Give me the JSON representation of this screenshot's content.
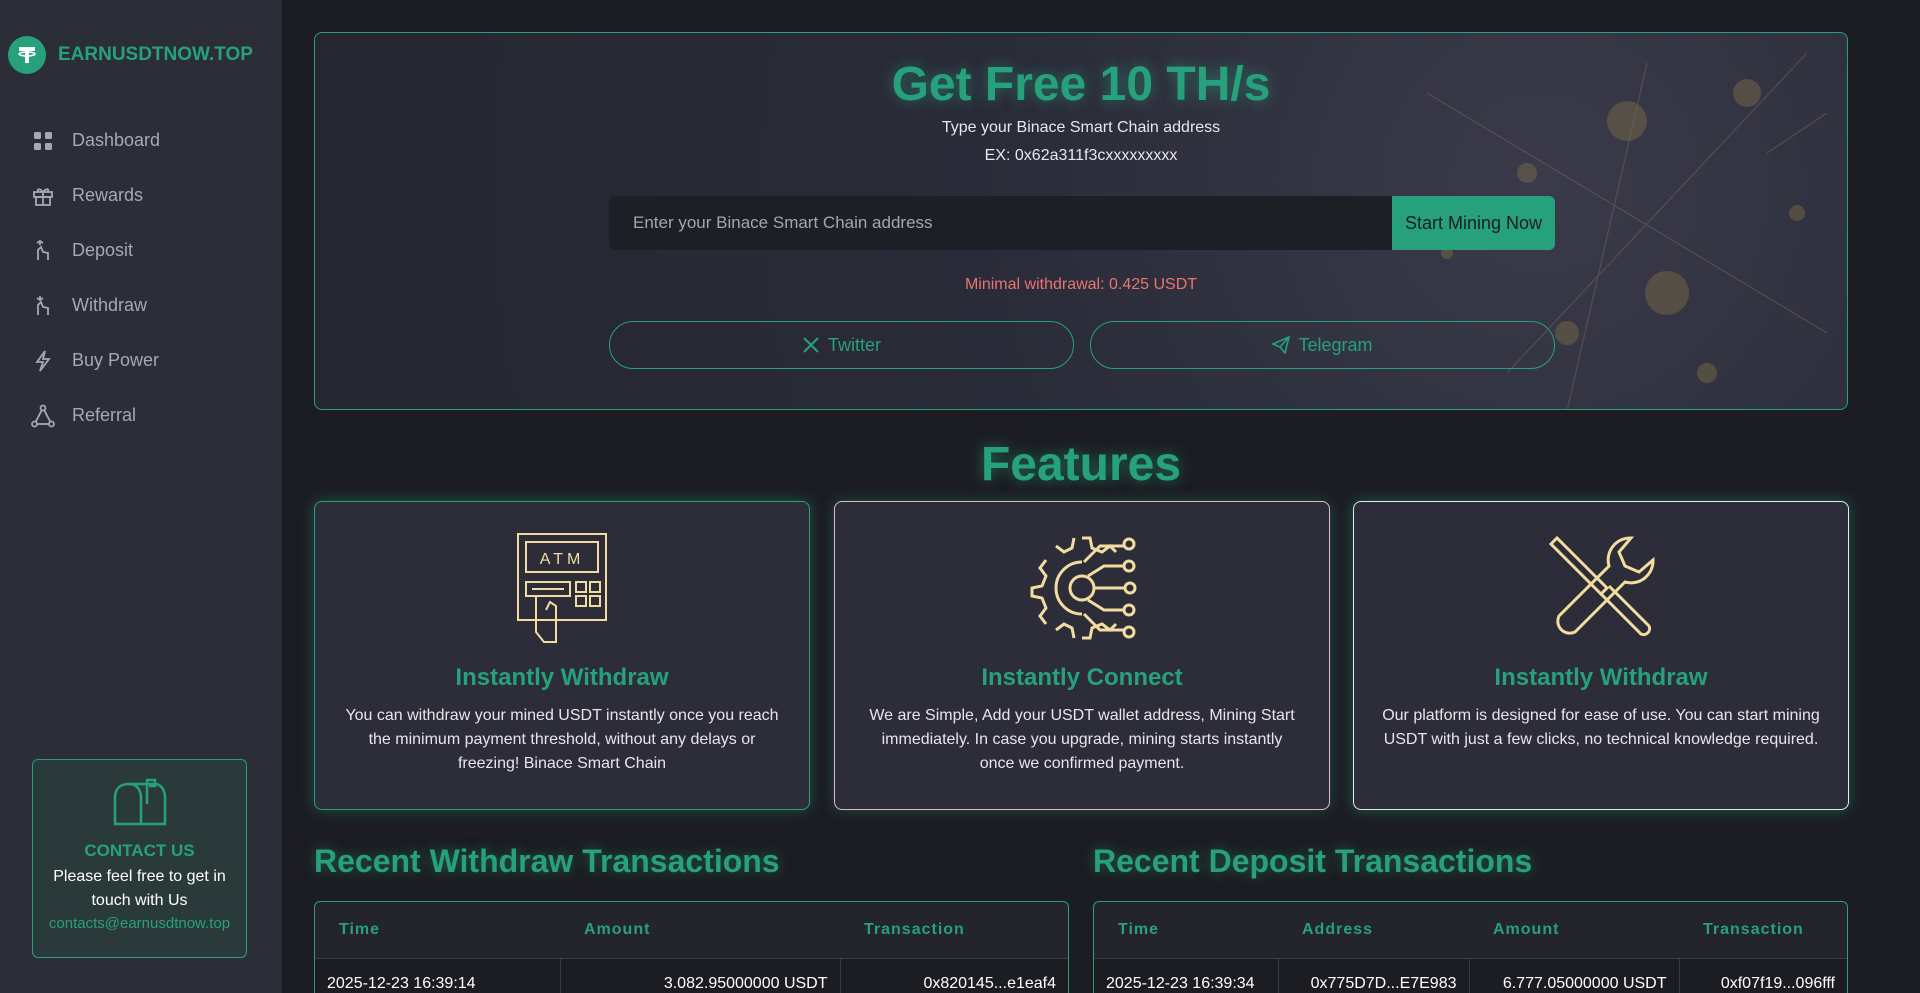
{
  "brand": {
    "name": "EARNUSDTNOW.TOP",
    "logo_icon": "tether-icon",
    "accent": "#26a17b"
  },
  "sidebar": {
    "items": [
      {
        "label": "Dashboard",
        "icon": "grid-icon"
      },
      {
        "label": "Rewards",
        "icon": "gift-icon"
      },
      {
        "label": "Deposit",
        "icon": "deposit-hand-icon"
      },
      {
        "label": "Withdraw",
        "icon": "withdraw-hand-icon"
      },
      {
        "label": "Buy Power",
        "icon": "lightning-icon"
      },
      {
        "label": "Referral",
        "icon": "network-icon"
      }
    ]
  },
  "contact": {
    "title": "CONTACT US",
    "text": "Please feel free to get in touch with Us",
    "email": "contacts@earnusdtnow.top"
  },
  "hero": {
    "title": "Get Free 10 TH/s",
    "subtitle": "Type your Binace Smart Chain address",
    "example": "EX: 0x62a311f3cxxxxxxxxx",
    "input_placeholder": "Enter your Binace Smart Chain address",
    "button": "Start Mining Now",
    "min_withdrawal": "Minimal withdrawal: 0.425 USDT",
    "twitter": "Twitter",
    "telegram": "Telegram"
  },
  "features": {
    "title": "Features",
    "cards": [
      {
        "title": "Instantly Withdraw",
        "text": "You can withdraw your mined USDT instantly once you reach the minimum payment threshold, without any delays or freezing! Binace Smart Chain",
        "icon": "atm-icon"
      },
      {
        "title": "Instantly Connect",
        "text": "We are Simple, Add your USDT wallet address, Mining Start immediately. In case you upgrade, mining starts instantly once we confirmed payment.",
        "icon": "gear-circuit-icon"
      },
      {
        "title": "Instantly Withdraw",
        "text": "Our platform is designed for ease of use. You can start mining USDT with just a few clicks, no technical knowledge required.",
        "icon": "tools-icon"
      }
    ]
  },
  "withdraw_tx": {
    "title": "Recent Withdraw Transactions",
    "headers": [
      "Time",
      "Amount",
      "Transaction"
    ],
    "rows": [
      [
        "2025-12-23 16:39:14",
        "3.082.95000000 USDT",
        "0x820145...e1eaf4"
      ]
    ]
  },
  "deposit_tx": {
    "title": "Recent Deposit Transactions",
    "headers": [
      "Time",
      "Address",
      "Amount",
      "Transaction"
    ],
    "rows": [
      [
        "2025-12-23 16:39:34",
        "0x775D7D...E7E983",
        "6.777.05000000 USDT",
        "0xf07f19...096fff"
      ]
    ]
  }
}
